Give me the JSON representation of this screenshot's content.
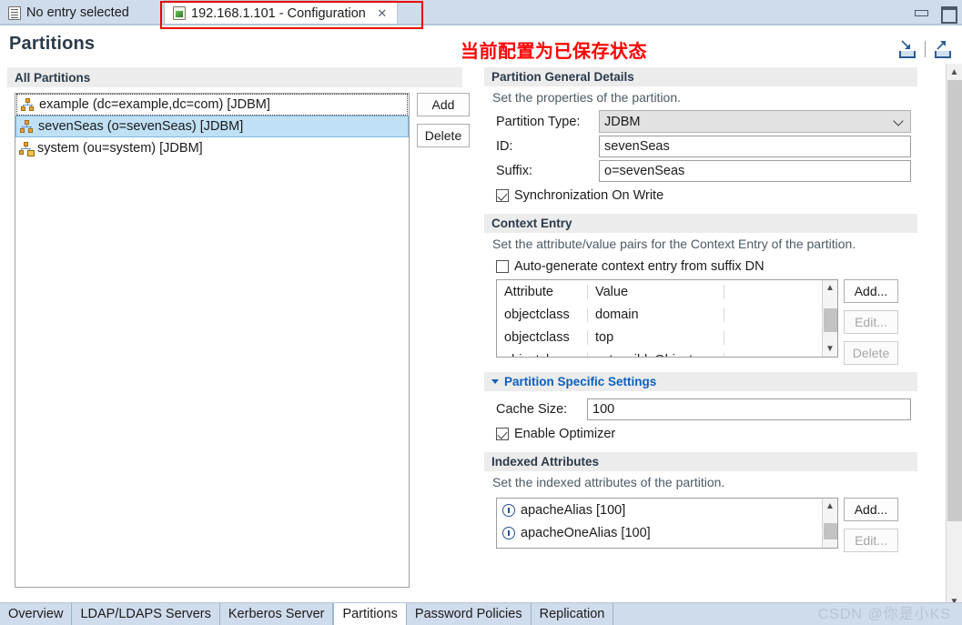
{
  "window": {
    "minimize_label": "minimize",
    "maximize_label": "maximize"
  },
  "editor_tabs": [
    {
      "label": "No entry selected",
      "icon": "document-icon",
      "active": false
    },
    {
      "label": "192.168.1.101 - Configuration",
      "icon": "configuration-icon",
      "active": true,
      "close": "✕"
    }
  ],
  "header": {
    "title": "Partitions",
    "annotation": "当前配置为已保存状态",
    "import_icon": "import-icon",
    "export_icon": "export-icon"
  },
  "left": {
    "section_title": "All Partitions",
    "partitions": [
      {
        "label": "example (dc=example,dc=com) [JDBM]",
        "state": "focused",
        "icon": "partition-icon"
      },
      {
        "label": "sevenSeas (o=sevenSeas) [JDBM]",
        "state": "selected",
        "icon": "partition-icon"
      },
      {
        "label": "system (ou=system) [JDBM]",
        "state": "normal",
        "icon": "partition-locked-icon"
      }
    ],
    "add_label": "Add",
    "delete_label": "Delete"
  },
  "general": {
    "section_title": "Partition General Details",
    "description": "Set the properties of the partition.",
    "partition_type_label": "Partition Type:",
    "partition_type_value": "JDBM",
    "id_label": "ID:",
    "id_value": "sevenSeas",
    "suffix_label": "Suffix:",
    "suffix_value": "o=sevenSeas",
    "sync_on_write_label": "Synchronization On Write",
    "sync_on_write_checked": true
  },
  "context_entry": {
    "section_title": "Context Entry",
    "description": "Set the attribute/value pairs for the Context Entry of the partition.",
    "autogen_label": "Auto-generate context entry from suffix DN",
    "autogen_checked": false,
    "columns": [
      "Attribute",
      "Value",
      ""
    ],
    "rows": [
      [
        "objectclass",
        "domain",
        ""
      ],
      [
        "objectclass",
        "top",
        ""
      ],
      [
        "objectclass",
        "extensibleObject",
        ""
      ]
    ],
    "add_label": "Add...",
    "edit_label": "Edit...",
    "delete_label": "Delete"
  },
  "specific": {
    "section_title": "Partition Specific Settings",
    "cache_size_label": "Cache Size:",
    "cache_size_value": "100",
    "enable_optimizer_label": "Enable Optimizer",
    "enable_optimizer_checked": true
  },
  "indexed": {
    "section_title": "Indexed Attributes",
    "description": "Set the indexed attributes of the partition.",
    "items": [
      "apacheAlias [100]",
      "apacheOneAlias [100]"
    ],
    "add_label": "Add...",
    "edit_label": "Edit..."
  },
  "bottom_tabs": [
    {
      "label": "Overview",
      "active": false
    },
    {
      "label": "LDAP/LDAPS Servers",
      "active": false
    },
    {
      "label": "Kerberos Server",
      "active": false
    },
    {
      "label": "Partitions",
      "active": true
    },
    {
      "label": "Password Policies",
      "active": false
    },
    {
      "label": "Replication",
      "active": false
    }
  ],
  "watermark": "CSDN @你是小KS",
  "colors": {
    "tab_strip": "#cfdcec",
    "annotation_red": "#fe0000",
    "selection_blue": "#bfe0f5",
    "link_blue": "#0d5fbf",
    "section_gray": "#ececec"
  }
}
